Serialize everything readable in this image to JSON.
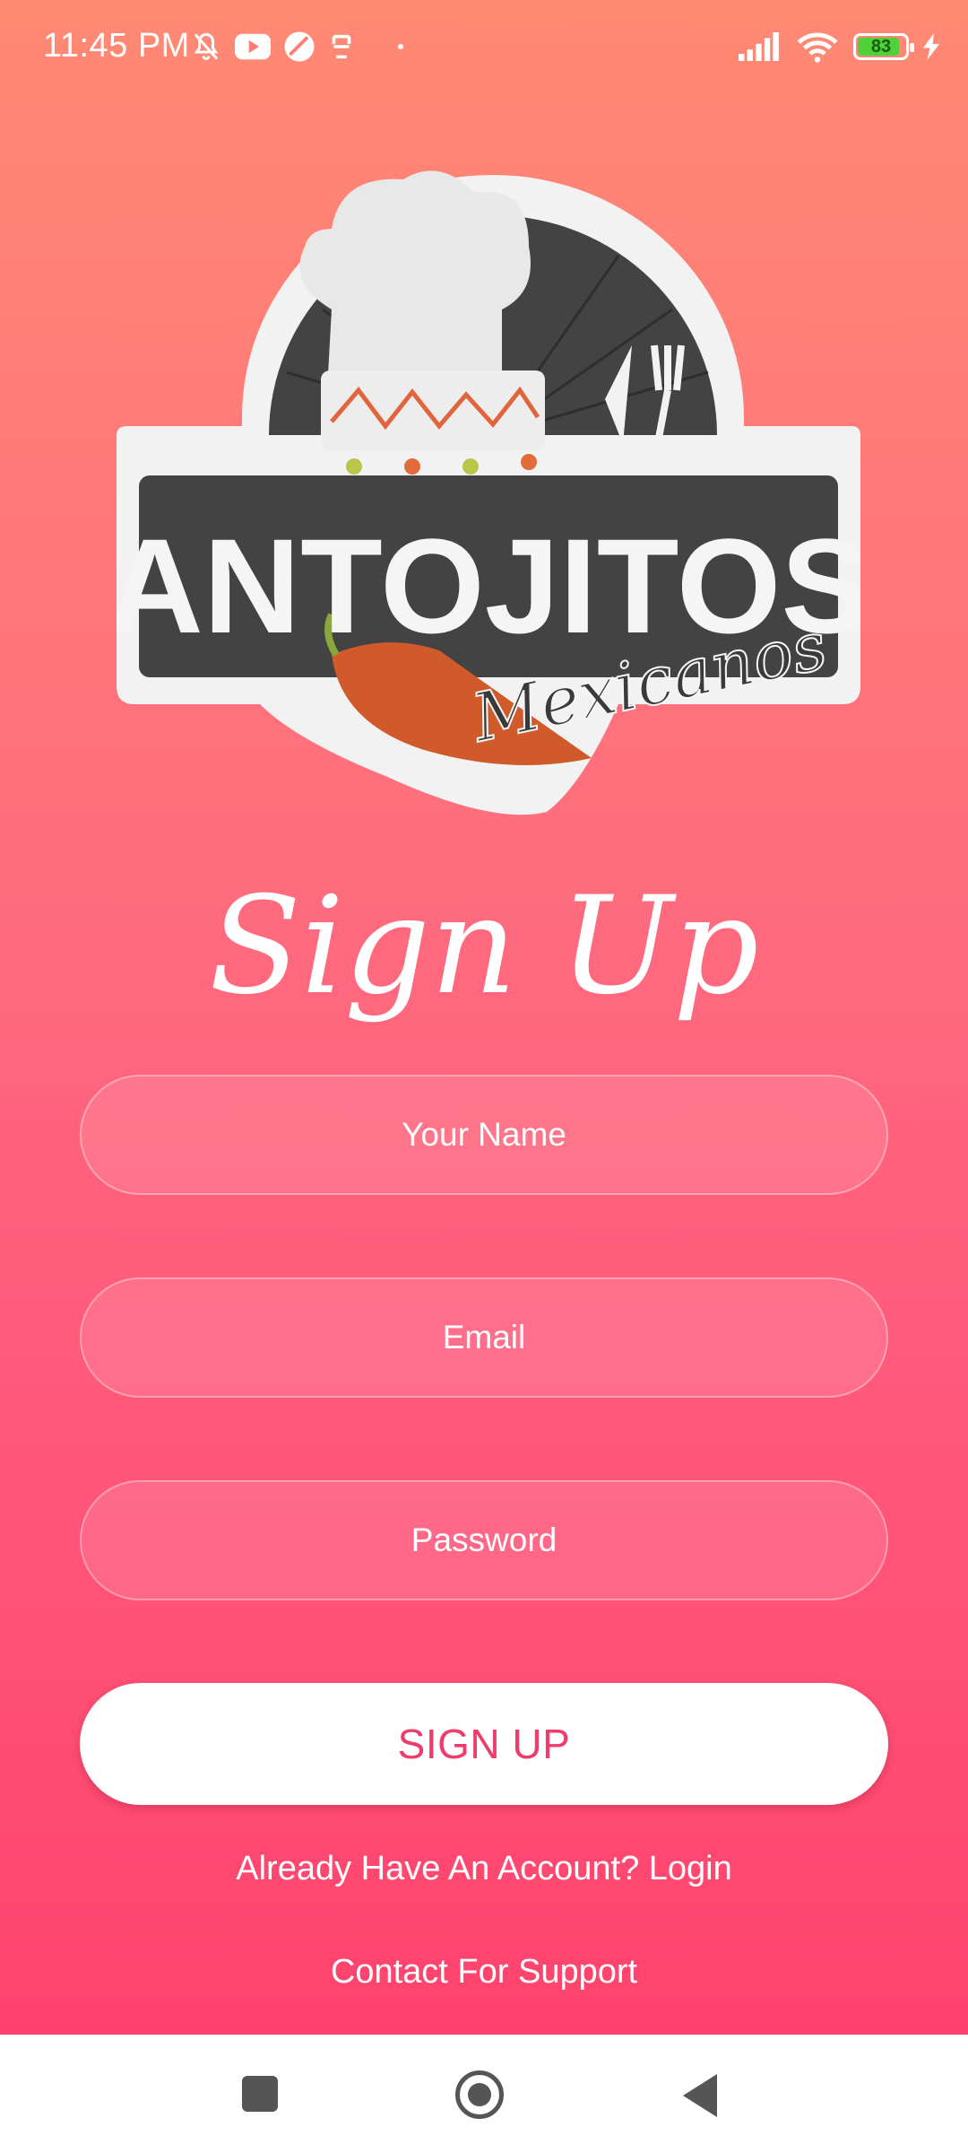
{
  "status_bar": {
    "time": "11:45 PM",
    "battery_level": "83",
    "icons": [
      "mute-bell-icon",
      "youtube-icon",
      "app-icon",
      "app-icon-2",
      "dot-icon",
      "signal-icon",
      "wifi-icon",
      "battery-icon",
      "charging-icon"
    ]
  },
  "logo": {
    "name": "ANTOJITOS",
    "subtitle": "Mexicanos"
  },
  "page": {
    "title": "Sign Up"
  },
  "form": {
    "name_placeholder": "Your Name",
    "name_value": "",
    "email_placeholder": "Email",
    "email_value": "",
    "password_placeholder": "Password",
    "password_value": "",
    "submit_label": "SIGN UP"
  },
  "links": {
    "login": "Already Have An Account? Login",
    "support": "Contact For Support"
  },
  "colors": {
    "gradient_top": "#ff8a73",
    "gradient_bottom": "#ff426d",
    "button_text": "#ee3d6c",
    "logo_dark": "#3f3f3f"
  },
  "nav_bar": {
    "buttons": [
      "recents-square-icon",
      "home-circle-icon",
      "back-triangle-icon"
    ]
  }
}
